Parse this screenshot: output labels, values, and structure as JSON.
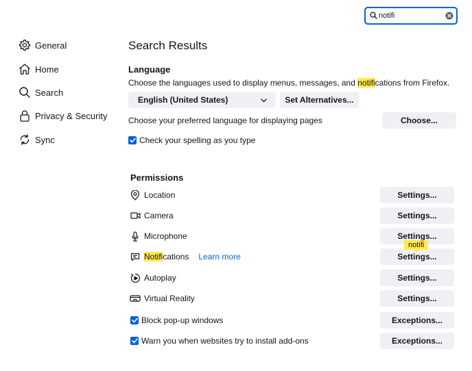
{
  "search": {
    "value": "notifi"
  },
  "sidebar": {
    "items": [
      {
        "label": "General",
        "icon": "gear-icon"
      },
      {
        "label": "Home",
        "icon": "home-icon"
      },
      {
        "label": "Search",
        "icon": "search-icon"
      },
      {
        "label": "Privacy & Security",
        "icon": "lock-icon"
      },
      {
        "label": "Sync",
        "icon": "sync-icon"
      }
    ]
  },
  "main": {
    "title": "Search Results",
    "language": {
      "heading": "Language",
      "desc_before": "Choose the languages used to display menus, messages, and ",
      "desc_highlight": "notifi",
      "desc_after": "cations from Firefox.",
      "selected_language": "English (United States)",
      "set_alternatives_label": "Set Alternatives...",
      "pages_desc": "Choose your preferred language for displaying pages",
      "choose_label": "Choose...",
      "spellcheck_label": "Check your spelling as you type",
      "spellcheck_checked": true
    },
    "permissions": {
      "heading": "Permissions",
      "rows": [
        {
          "label": "Location",
          "button": "Settings...",
          "icon": "location-pin-icon"
        },
        {
          "label": "Camera",
          "button": "Settings...",
          "icon": "camera-icon"
        },
        {
          "label": "Microphone",
          "button": "Settings...",
          "icon": "microphone-icon"
        },
        {
          "label_highlight": "Notifi",
          "label_rest": "cations",
          "learn_more": "Learn more",
          "button": "Settings...",
          "icon": "notification-icon"
        },
        {
          "label": "Autoplay",
          "button": "Settings...",
          "icon": "autoplay-icon"
        },
        {
          "label": "Virtual Reality",
          "button": "Settings...",
          "icon": "vr-headset-icon"
        }
      ],
      "block_popups_label": "Block pop-up windows",
      "block_popups_checked": true,
      "warn_addons_label": "Warn you when websites try to install add-ons",
      "warn_addons_checked": true,
      "exceptions_label": "Exceptions..."
    },
    "tooltip": "notifi"
  },
  "colors": {
    "accent": "#0061e0",
    "highlight": "#ffe94f",
    "button_bg": "#f0f0f4",
    "text": "#15141a"
  }
}
